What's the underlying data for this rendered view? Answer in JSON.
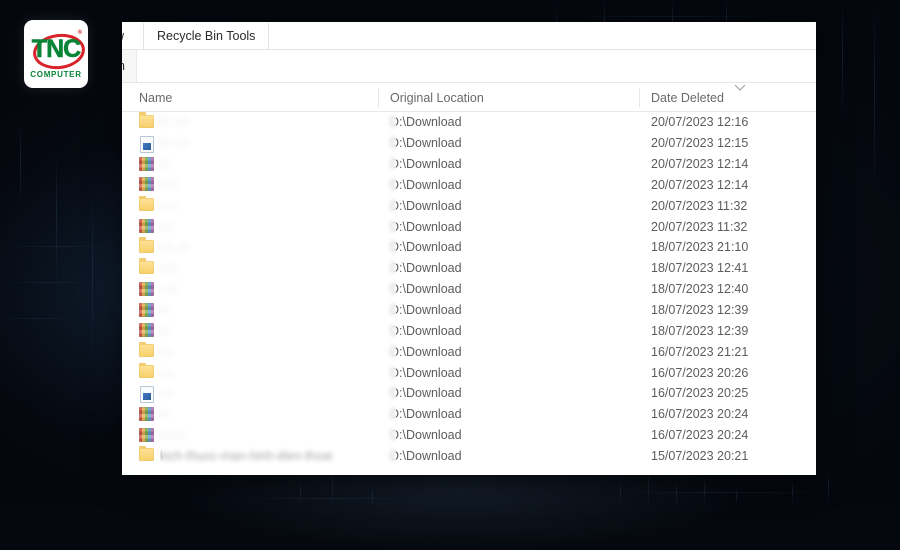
{
  "branding": {
    "logo_letters": "TNC",
    "logo_subtitle": "COMPUTER",
    "logo_registered_mark": "®",
    "logo_green": "#0a8537",
    "logo_red": "#d8232a"
  },
  "window": {
    "ribbon_tabs": [
      {
        "label": "w",
        "clipped": true
      },
      {
        "label": "Recycle Bin Tools",
        "clipped": false
      }
    ],
    "ribbon_group_label": "n"
  },
  "columns": {
    "name": "Name",
    "original_location": "Original Location",
    "date_deleted": "Date Deleted",
    "sort_indicator": "chevron-down-icon"
  },
  "rows": [
    {
      "icon": "folder-icon",
      "name": "lic                              nh",
      "redacted": true,
      "location": "D:\\Download",
      "date": "20/07/2023 12:16"
    },
    {
      "icon": "document-icon",
      "name": "lic                              nh",
      "redacted": true,
      "location": "D:\\Download",
      "date": "20/07/2023 12:15"
    },
    {
      "icon": "image-icon",
      "name": "ilc",
      "redacted": true,
      "location": "D:\\Download",
      "date": "20/07/2023 12:14"
    },
    {
      "icon": "image-icon",
      "name": "li                               ih",
      "redacted": true,
      "location": "D:\\Download",
      "date": "20/07/2023 12:14"
    },
    {
      "icon": "folder-icon",
      "name": "sm",
      "redacted": true,
      "location": "D:\\Download",
      "date": "20/07/2023 11:32"
    },
    {
      "icon": "image-icon",
      "name": "sn",
      "redacted": true,
      "location": "D:\\Download",
      "date": "20/07/2023 11:32"
    },
    {
      "icon": "folder-icon",
      "name": "ca                              all",
      "redacted": true,
      "location": "D:\\Download",
      "date": "18/07/2023 21:10"
    },
    {
      "icon": "folder-icon",
      "name": "cac",
      "redacted": true,
      "location": "D:\\Download",
      "date": "18/07/2023 12:41"
    },
    {
      "icon": "image-icon",
      "name": "cac",
      "redacted": true,
      "location": "D:\\Download",
      "date": "18/07/2023 12:40"
    },
    {
      "icon": "image-icon",
      "name": "ilc",
      "redacted": true,
      "location": "D:\\Download",
      "date": "18/07/2023 12:39"
    },
    {
      "icon": "image-icon",
      "name": "ilc",
      "redacted": true,
      "location": "D:\\Download",
      "date": "18/07/2023 12:39"
    },
    {
      "icon": "folder-icon",
      "name": "ca",
      "redacted": true,
      "location": "D:\\Download",
      "date": "16/07/2023 21:21"
    },
    {
      "icon": "folder-icon",
      "name": "ca",
      "redacted": true,
      "location": "D:\\Download",
      "date": "16/07/2023 20:26"
    },
    {
      "icon": "document-icon",
      "name": "ca",
      "redacted": true,
      "location": "D:\\Download",
      "date": "16/07/2023 20:25"
    },
    {
      "icon": "image-icon",
      "name": "ilc",
      "redacted": true,
      "location": "D:\\Download",
      "date": "16/07/2023 20:24"
    },
    {
      "icon": "image-icon",
      "name": "cach",
      "redacted": true,
      "location": "D:\\Download",
      "date": "16/07/2023 20:24"
    },
    {
      "icon": "folder-icon",
      "name": "kich-thuoc-man-hinh-dien-thoai",
      "redacted": false,
      "location": "D:\\Download",
      "date": "15/07/2023 20:21"
    }
  ]
}
